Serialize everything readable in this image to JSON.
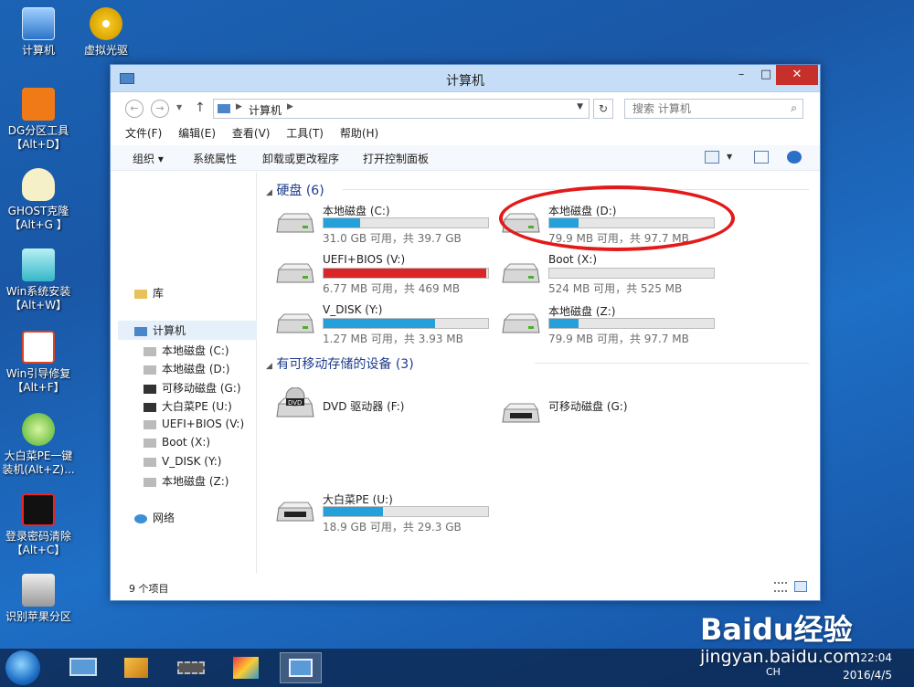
{
  "desktop": {
    "icons": [
      {
        "label": "计算机"
      },
      {
        "label": "虚拟光驱"
      },
      {
        "label": "DG分区工具\n【Alt+D】"
      },
      {
        "label": "GHOST克隆\n【Alt+G 】"
      },
      {
        "label": "Win系统安装\n【Alt+W】"
      },
      {
        "label": "Win引导修复\n【Alt+F】"
      },
      {
        "label": "大白菜PE一键\n装机(Alt+Z)..."
      },
      {
        "label": "登录密码清除\n【Alt+C】"
      },
      {
        "label": "识别苹果分区"
      }
    ]
  },
  "window": {
    "title": "计算机",
    "minimize": "–",
    "maximize": "□",
    "close": "✕",
    "address": {
      "path": "计算机"
    },
    "search": {
      "placeholder": "搜索 计算机"
    },
    "menu": [
      "文件(F)",
      "编辑(E)",
      "查看(V)",
      "工具(T)",
      "帮助(H)"
    ],
    "toolbar": {
      "organize": "组织 ▾",
      "system_props": "系统属性",
      "uninstall": "卸载或更改程序",
      "control_panel": "打开控制面板"
    },
    "nav": {
      "library": "库",
      "computer": "计算机",
      "drives": [
        "本地磁盘 (C:)",
        "本地磁盘 (D:)",
        "可移动磁盘 (G:)",
        "大白菜PE (U:)",
        "UEFI+BIOS (V:)",
        "Boot (X:)",
        "V_DISK (Y:)",
        "本地磁盘 (Z:)"
      ],
      "network": "网络"
    },
    "groups": {
      "hard_disks": "硬盘 (6)",
      "removable": "有可移动存储的设备 (3)"
    },
    "drives": [
      {
        "name": "本地磁盘 (C:)",
        "space": "31.0 GB 可用，共 39.7 GB",
        "used_fraction": 0.22
      },
      {
        "name": "本地磁盘 (D:)",
        "space": "79.9 MB 可用，共 97.7 MB",
        "used_fraction": 0.18
      },
      {
        "name": "UEFI+BIOS (V:)",
        "space": "6.77 MB 可用，共 469 MB",
        "used_fraction": 0.99
      },
      {
        "name": "Boot (X:)",
        "space": "524 MB 可用，共 525 MB",
        "used_fraction": 0.0
      },
      {
        "name": "V_DISK (Y:)",
        "space": "1.27 MB 可用，共 3.93 MB",
        "used_fraction": 0.68
      },
      {
        "name": "本地磁盘 (Z:)",
        "space": "79.9 MB 可用，共 97.7 MB",
        "used_fraction": 0.18
      }
    ],
    "removable": [
      {
        "name": "DVD 驱动器 (F:)"
      },
      {
        "name": "可移动磁盘 (G:)"
      },
      {
        "name": "大白菜PE (U:)",
        "space": "18.9 GB 可用，共 29.3 GB",
        "used_fraction": 0.36
      }
    ],
    "status": "9 个项目"
  },
  "taskbar": {
    "lang": "CH",
    "time": "22:04",
    "date": "2016/4/5"
  },
  "watermark": {
    "logo": "Baidu经验",
    "url": "jingyan.baidu.com"
  }
}
